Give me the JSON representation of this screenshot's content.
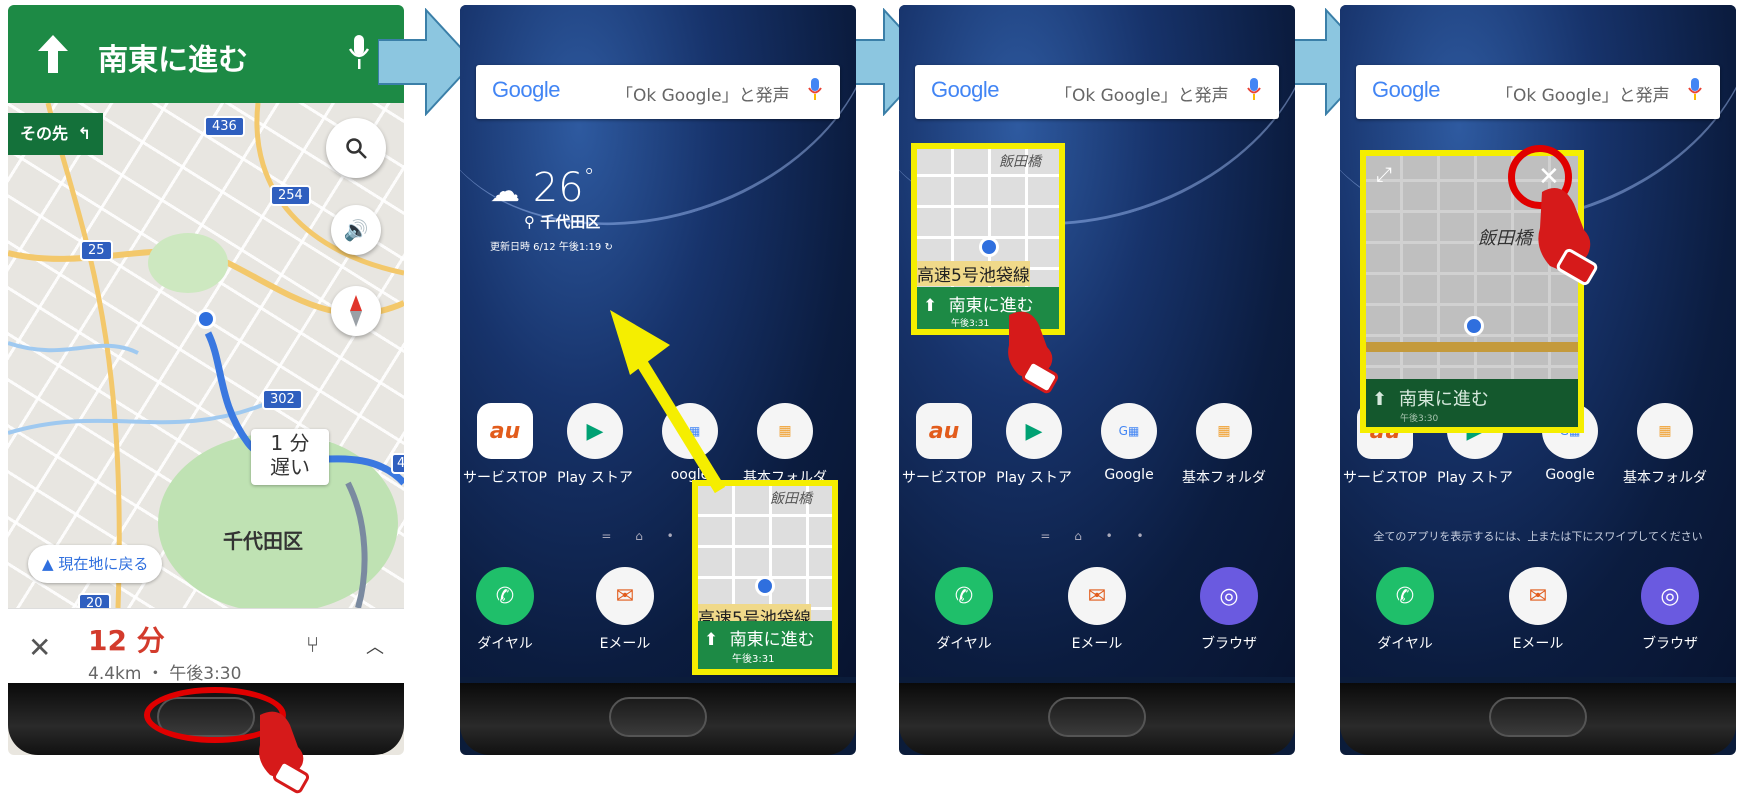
{
  "colors": {
    "nav_green": "#1d8a45",
    "pip_outline": "#f5ee00",
    "callout_red": "#e00000",
    "arrow_blue": "#8cc6e0",
    "eta_red": "#d33b2c"
  },
  "screen1": {
    "banner": {
      "direction_text": "南東に進む",
      "arrow_icon": "up-arrow-icon",
      "mic_icon": "mic-icon"
    },
    "then_chip": "その先",
    "route_badges": [
      "436",
      "254",
      "25",
      "302",
      "20",
      "4"
    ],
    "delay_bubble": {
      "line1": "1 分",
      "line2": "遅い"
    },
    "district_label": "千代田区",
    "recenter_button": "現在地に戻る",
    "footer": {
      "eta": "12 分",
      "distance_time": "4.4km ・ 午後3:30"
    },
    "controls": [
      "search-icon",
      "volume-icon",
      "compass-icon"
    ]
  },
  "home": {
    "search": {
      "logo": "Google",
      "hint": "「Ok Google」と発声"
    },
    "weather": {
      "temp": "26",
      "unit": "°",
      "location": "千代田区",
      "updated": "更新日時 6/12 午後1:19"
    },
    "apps": [
      "サービスTOP",
      "Play ストア",
      "Google",
      "基本フォルダ"
    ],
    "swipe_hint": "全てのアプリを表示するには、上または下にスワイプしてください",
    "dock": [
      "ダイヤル",
      "Eメール",
      "ブラウザ"
    ],
    "dock_partial_label": "oogle",
    "folder_partial_label": "基本フォルダ"
  },
  "pip": {
    "road_label": "高速5号池袋線",
    "bridge_label": "飯田橋",
    "direction": "南東に進む",
    "time": "午後3:31",
    "time_small": "午後3:30"
  }
}
